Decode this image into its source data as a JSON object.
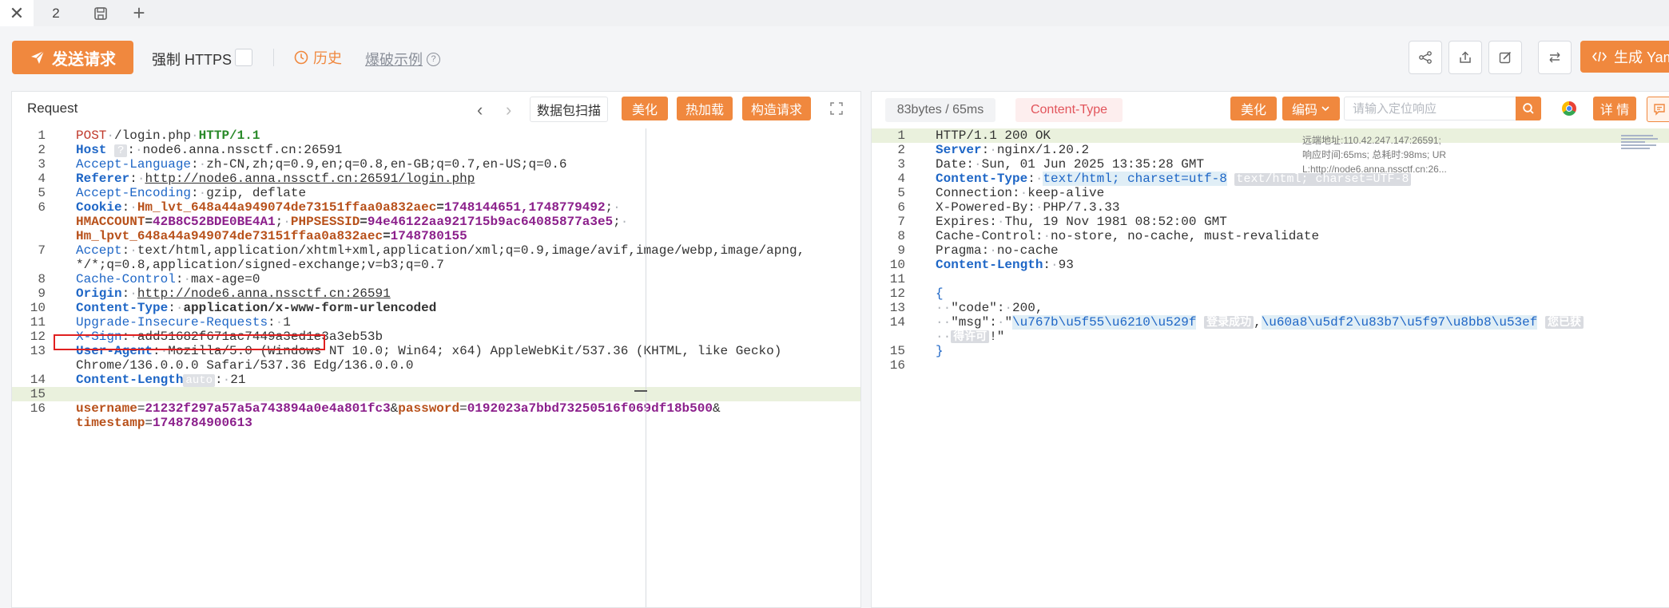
{
  "tabs": {
    "close_glyph": "✕",
    "tab_label": "2",
    "add_glyph": "+"
  },
  "toolbar": {
    "send_label": "发送请求",
    "force_https_label": "强制 HTTPS",
    "history_label": "历史",
    "example_label": "爆破示例",
    "help_glyph": "?",
    "generate_label": "生成 Yam"
  },
  "request": {
    "title": "Request",
    "scan_label": "数据包扫描",
    "beautify_label": "美化",
    "hotload_label": "热加载",
    "construct_label": "构造请求",
    "lines": {
      "l1": {
        "method": "POST",
        "path": "/login.php",
        "version": "HTTP/1.1"
      },
      "l2": {
        "key": "Host",
        "badge": "?",
        "value": "node6.anna.nssctf.cn:26591"
      },
      "l3": {
        "key": "Accept-Language",
        "value": "zh-CN,zh;q=0.9,en;q=0.8,en-GB;q=0.7,en-US;q=0.6"
      },
      "l4": {
        "key": "Referer",
        "value": "http://node6.anna.nssctf.cn:26591/login.php"
      },
      "l5": {
        "key": "Accept-Encoding",
        "value": "gzip, deflate"
      },
      "l6": {
        "key": "Cookie",
        "c1_name": "Hm_lvt_648a44a949074de73151ffaa0a832aec",
        "c1_val": "1748144651,1748779492",
        "c2_name": "HMACCOUNT",
        "c2_val": "42B8C52BDE0BE4A1",
        "c3_name": "PHPSESSID",
        "c3_val": "94e46122aa921715b9ac64085877a3e5",
        "c4_name": "Hm_lpvt_648a44a949074de73151ffaa0a832aec",
        "c4_val": "1748780155"
      },
      "l7": {
        "key": "Accept",
        "value_a": "text/html,application/xhtml+xml,application/xml;q=0.9,image/avif,image/webp,image/apng,",
        "value_b": "*/*;q=0.8,application/signed-exchange;v=b3;q=0.7"
      },
      "l8": {
        "key": "Cache-Control",
        "value": "max-age=0"
      },
      "l9": {
        "key": "Origin",
        "value": "http://node6.anna.nssctf.cn:26591"
      },
      "l10": {
        "key": "Content-Type",
        "value": "application/x-www-form-urlencoded"
      },
      "l11": {
        "key": "Upgrade-Insecure-Requests",
        "value": "1"
      },
      "l12": {
        "key": "X-Sign",
        "value": "add51682f671ac7449a3ed1e3a3eb53b"
      },
      "l13": {
        "key": "User-Agent",
        "value_a": "Mozilla/5.0 (Windows NT 10.0; Win64; x64) AppleWebKit/537.36 (KHTML, like Gecko)",
        "value_b": "Chrome/136.0.0.0 Safari/537.36 Edg/136.0.0.0"
      },
      "l14": {
        "key": "Content-Length",
        "badge": "auto",
        "value": "21"
      },
      "l16": {
        "p1_name": "username",
        "p1_val": "21232f297a57a5a743894a0e4a801fc3",
        "p2_name": "password",
        "p2_val": "0192023a7bbd73250516f069df18b500",
        "p3_name": "timestamp",
        "p3_val": "1748784900613"
      }
    }
  },
  "response": {
    "size_label": "83bytes / 65ms",
    "content_type_label": "Content-Type",
    "beautify_label": "美化",
    "encode_label": "编码",
    "locate_placeholder": "请输入定位响应",
    "detail_label": "详 情",
    "meta": {
      "remote": "远端地址:110.42.247.147:26591;",
      "timing": "响应时间:65ms; 总耗时:98ms; UR",
      "url": "L:http://node6.anna.nssctf.cn:26..."
    },
    "lines": {
      "l1": "HTTP/1.1 200 OK",
      "l2": {
        "key": "Server",
        "value": "nginx/1.20.2"
      },
      "l3": {
        "key": "Date",
        "value": "Sun, 01 Jun 2025 13:35:28 GMT"
      },
      "l4": {
        "key": "Content-Type",
        "value": "text/html; charset=utf-8",
        "hint": "text/html; charset=UTF-8"
      },
      "l5": {
        "key": "Connection",
        "value": "keep-alive"
      },
      "l6": {
        "key": "X-Powered-By",
        "value": "PHP/7.3.33"
      },
      "l7": {
        "key": "Expires",
        "value": "Thu, 19 Nov 1981 08:52:00 GMT"
      },
      "l8": {
        "key": "Cache-Control",
        "value": "no-store, no-cache, must-revalidate"
      },
      "l9": {
        "key": "Pragma",
        "value": "no-cache"
      },
      "l10": {
        "key": "Content-Length",
        "value": "93"
      },
      "l12": "{",
      "l13": {
        "key": "\"code\"",
        "value": "200,"
      },
      "l14": {
        "key": "\"msg\"",
        "u1": "\\u767b\\u5f55\\u6210\\u529f",
        "h1": "登录成功",
        "u2": "\\u60a8\\u5df2\\u83b7\\u5f97\\u8bb8\\u53ef",
        "h2a": "您已获",
        "h2b": "得许可",
        "tail": "!\""
      },
      "l15": "}"
    }
  }
}
